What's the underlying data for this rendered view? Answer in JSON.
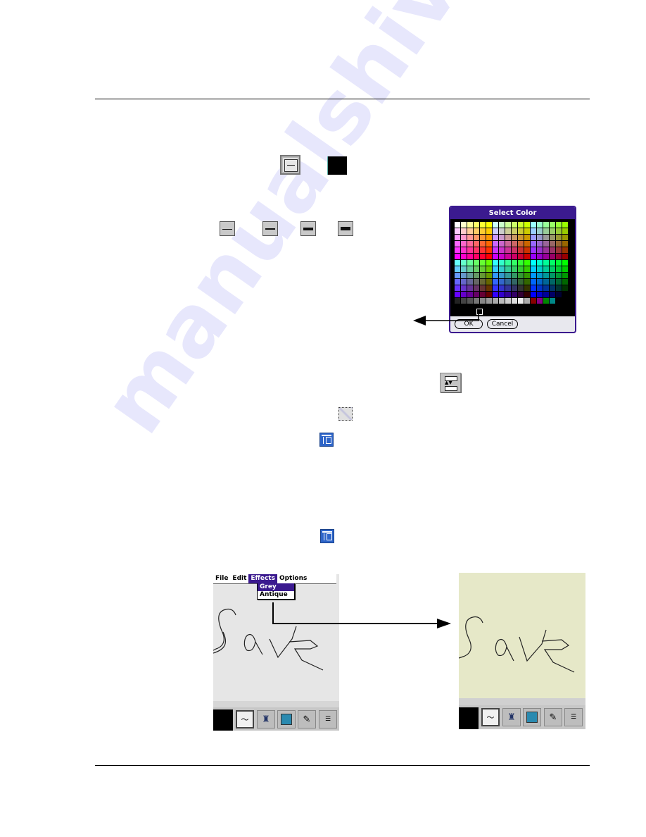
{
  "page": {
    "watermark": "manualshive.com"
  },
  "line_width_icon": {
    "name": "line-width-button"
  },
  "color_icon": {
    "name": "color-swatch",
    "color": "#000000"
  },
  "line_widths": [
    "thin",
    "medium",
    "thick",
    "extra-thick"
  ],
  "select_color_dialog": {
    "title": "Select Color",
    "ok_label": "OK",
    "cancel_label": "Cancel",
    "selected_color": "#000000",
    "title_color": "#3b1a8f"
  },
  "icons": {
    "transfer_icon": "transfer-icon",
    "eraser_selection_icon": "selection-rect-icon",
    "scroll_doc_icon_1": "document-scroll-icon",
    "scroll_doc_icon_2": "document-scroll-icon"
  },
  "left_device": {
    "menu": [
      "File",
      "Edit",
      "Effects",
      "Options"
    ],
    "active_menu": "Effects",
    "dropdown": [
      "Grey",
      "Antique"
    ],
    "highlighted_item": "Grey",
    "canvas_color": "#e6e6e6",
    "sketch_text": "Save",
    "toolbar": [
      "color",
      "line",
      "stamp",
      "picture",
      "pen",
      "transfer"
    ]
  },
  "right_device": {
    "canvas_color": "#e6e8c8",
    "sketch_text": "Save",
    "toolbar": [
      "color",
      "line",
      "stamp",
      "picture",
      "pen",
      "transfer"
    ]
  }
}
